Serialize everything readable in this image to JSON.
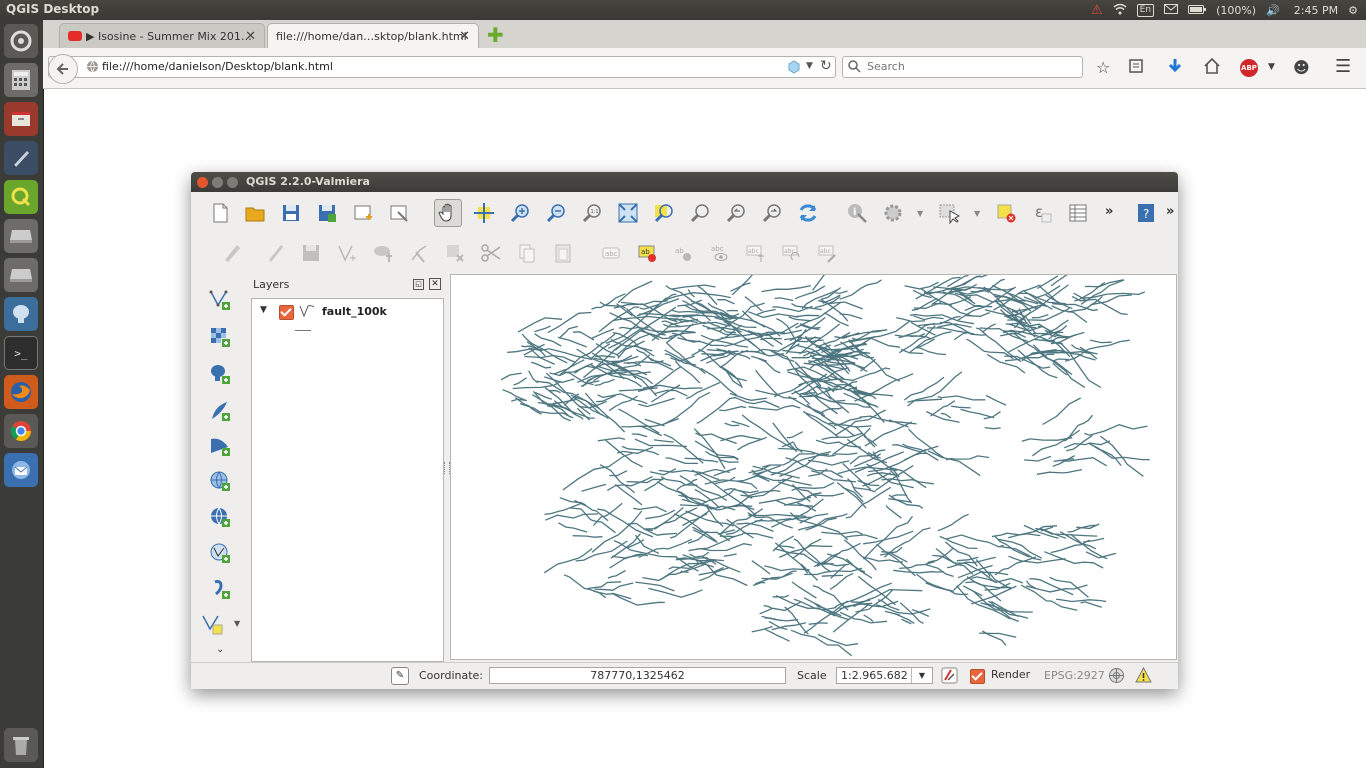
{
  "panel": {
    "title": "QGIS Desktop",
    "keyboard": "En",
    "battery": "(100%)",
    "clock": "2:45 PM"
  },
  "browser": {
    "tabs": [
      {
        "label": "▶ Isosine - Summer Mix 201…"
      },
      {
        "label": "file:///home/dan…sktop/blank.html"
      }
    ],
    "url": "file:///home/danielson/Desktop/blank.html",
    "search_placeholder": "Search",
    "adblock": "ABP"
  },
  "qgis": {
    "title": "QGIS 2.2.0-Valmiera",
    "layers_title": "Layers",
    "layer_name": "fault_100k",
    "status": {
      "coordinate_label": "Coordinate:",
      "coordinate_value": "787770,1325462",
      "scale_label": "Scale",
      "scale_value": "1:2.965.682",
      "render_label": "Render",
      "crs": "EPSG:2927"
    }
  },
  "colors": {
    "fault_lines": "#4e7680",
    "checkbox": "#e9653b"
  }
}
